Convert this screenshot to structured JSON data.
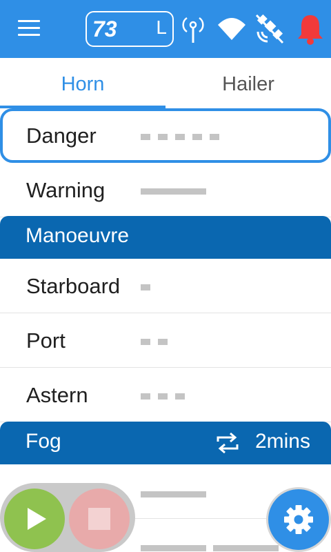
{
  "header": {
    "channel_number": "73",
    "channel_mode": "L",
    "icons": [
      "menu-icon",
      "antenna-icon",
      "wifi-icon",
      "gps-off-icon",
      "alarm-bell-icon"
    ],
    "colors": {
      "bar": "#2f8fe6",
      "alarm": "#f13a3a"
    }
  },
  "tabs": [
    {
      "label": "Horn",
      "active": true
    },
    {
      "label": "Hailer",
      "active": false
    }
  ],
  "signals": {
    "danger": {
      "label": "Danger",
      "pattern": "short-short-short-short-short"
    },
    "warning": {
      "label": "Warning",
      "pattern": "long"
    }
  },
  "manoeuvre": {
    "title": "Manoeuvre",
    "items": [
      {
        "label": "Starboard",
        "pattern": "short"
      },
      {
        "label": "Port",
        "pattern": "short-short"
      },
      {
        "label": "Astern",
        "pattern": "short-short-short"
      }
    ]
  },
  "fog": {
    "title": "Fog",
    "interval": "2mins",
    "icons": [
      "repeat-icon"
    ]
  },
  "controls": {
    "icons": [
      "play-icon",
      "stop-icon",
      "settings-gear-icon"
    ],
    "colors": {
      "play": "#8fc24f",
      "stop": "#e8aaaa",
      "settings": "#2f8fe6"
    }
  }
}
